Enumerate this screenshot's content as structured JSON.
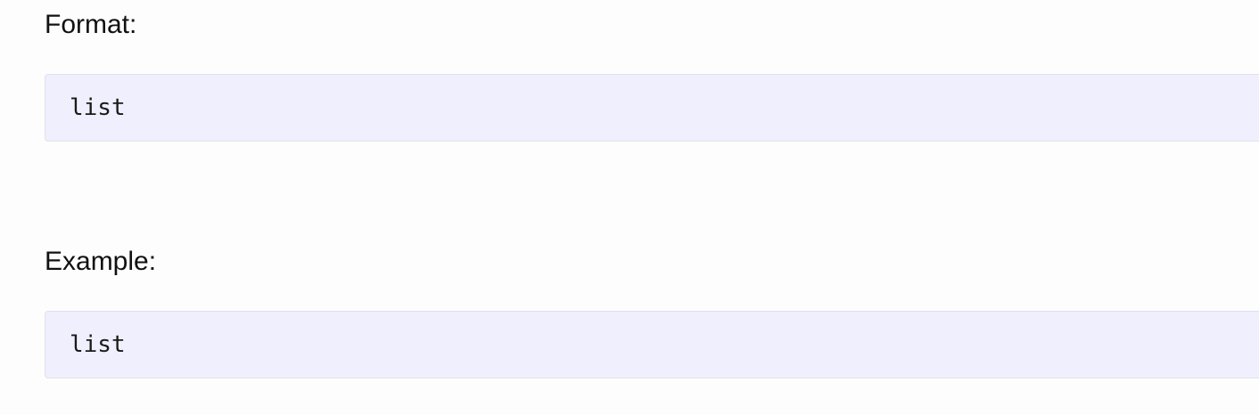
{
  "sections": [
    {
      "heading": "Format:",
      "code": "list"
    },
    {
      "heading": "Example:",
      "code": "list"
    }
  ],
  "colors": {
    "background": "#fdfdfd",
    "code_background": "#efeffd",
    "code_border": "#e2e2ec",
    "text": "#111111"
  }
}
